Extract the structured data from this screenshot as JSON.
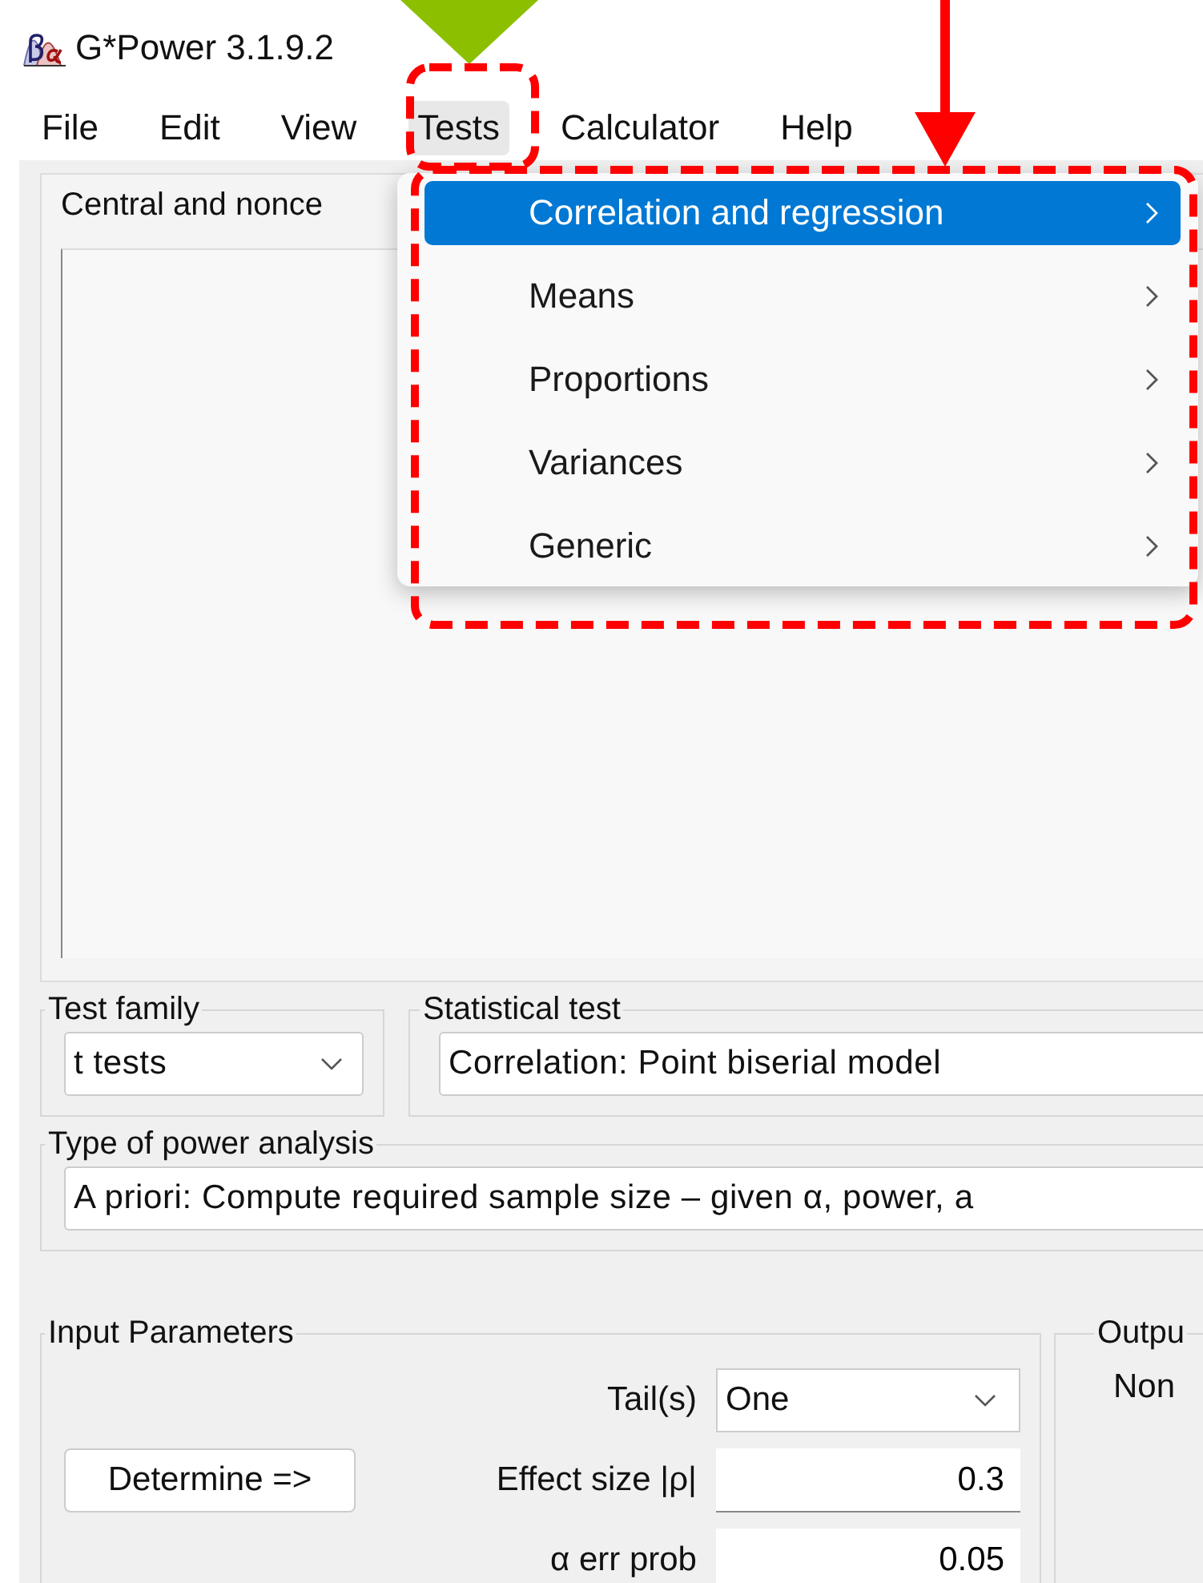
{
  "window": {
    "title": "G*Power 3.1.9.2"
  },
  "menu_bar": [
    {
      "label": "File",
      "selected": false
    },
    {
      "label": "Edit",
      "selected": false
    },
    {
      "label": "View",
      "selected": false
    },
    {
      "label": "Tests",
      "selected": true
    },
    {
      "label": "Calculator",
      "selected": false
    },
    {
      "label": "Help",
      "selected": false
    }
  ],
  "tests_menu": {
    "items": [
      {
        "label": "Correlation and regression",
        "selected": true
      },
      {
        "label": "Means",
        "selected": false
      },
      {
        "label": "Proportions",
        "selected": false
      },
      {
        "label": "Variances",
        "selected": false
      },
      {
        "label": "Generic",
        "selected": false
      }
    ]
  },
  "distribution_panel": {
    "title": "Central and nonce"
  },
  "test_family": {
    "label": "Test family",
    "value": "t tests"
  },
  "statistical_test": {
    "label": "Statistical test",
    "value": "Correlation: Point biserial model"
  },
  "power_analysis": {
    "label": "Type of power analysis",
    "value": "A priori: Compute required sample size – given α, power, a"
  },
  "input_parameters": {
    "title": "Input Parameters",
    "button": "Determine =>",
    "fields": [
      {
        "kind": "select",
        "label": "Tail(s)",
        "value": "One"
      },
      {
        "kind": "number",
        "label": "Effect size |ρ|",
        "value": "0.3"
      },
      {
        "kind": "number",
        "label": "α err prob",
        "value": "0.05"
      }
    ]
  },
  "output_parameters": {
    "title": "Outpu",
    "text": "Non"
  },
  "annotations": [
    {
      "kind": "arrow",
      "color": "#8cbf00"
    },
    {
      "kind": "frame",
      "color": "#ff0000"
    },
    {
      "kind": "arrow",
      "color": "#ff0000"
    },
    {
      "kind": "frame",
      "color": "#ff0000"
    }
  ]
}
